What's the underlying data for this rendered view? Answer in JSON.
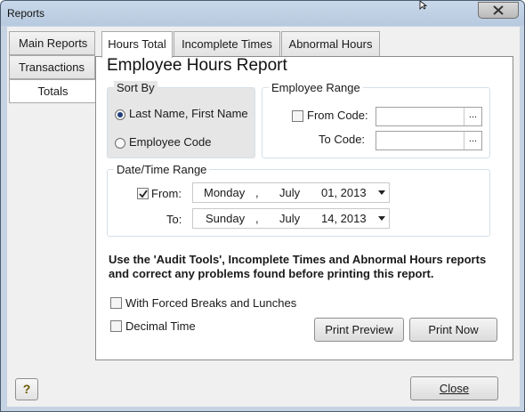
{
  "window": {
    "title": "Reports"
  },
  "left_tabs": [
    {
      "label": "Main Reports",
      "active": false
    },
    {
      "label": "Transactions",
      "active": false
    },
    {
      "label": "Totals",
      "active": true
    }
  ],
  "top_tabs": [
    {
      "label": "Hours Total",
      "active": true
    },
    {
      "label": "Incomplete Times",
      "active": false
    },
    {
      "label": "Abnormal Hours",
      "active": false
    }
  ],
  "report_title": "Employee Hours Report",
  "sort_by": {
    "label": "Sort By",
    "options": [
      {
        "label": "Last Name, First Name",
        "selected": true
      },
      {
        "label": "Employee Code",
        "selected": false
      }
    ]
  },
  "employee_range": {
    "label": "Employee Range",
    "from_label": "From Code:",
    "from_checked": false,
    "from_value": "",
    "to_label": "To Code:",
    "to_value": "",
    "browse": "..."
  },
  "date_range": {
    "label": "Date/Time Range",
    "from_label": "From:",
    "from_checked": true,
    "from": {
      "day": "Monday",
      "month": "July",
      "date": "01, 2013"
    },
    "to_label": "To:",
    "to": {
      "day": "Sunday",
      "month": "July",
      "date": "14, 2013"
    },
    "sep": ","
  },
  "note": "Use the 'Audit Tools', Incomplete Times and Abnormal Hours reports and correct any problems found before printing this report.",
  "options": [
    {
      "label": "With Forced Breaks and Lunches",
      "checked": false
    },
    {
      "label": "Decimal Time",
      "checked": false
    }
  ],
  "buttons": {
    "print_preview": "Print Preview",
    "print_now": "Print Now",
    "close_label": "Close",
    "help": "?"
  },
  "colors": {
    "title_bar": "#c9d8ea",
    "frame": "#c6d3e3",
    "client": "#f0f0f0",
    "accent": "#1f3f7a"
  }
}
